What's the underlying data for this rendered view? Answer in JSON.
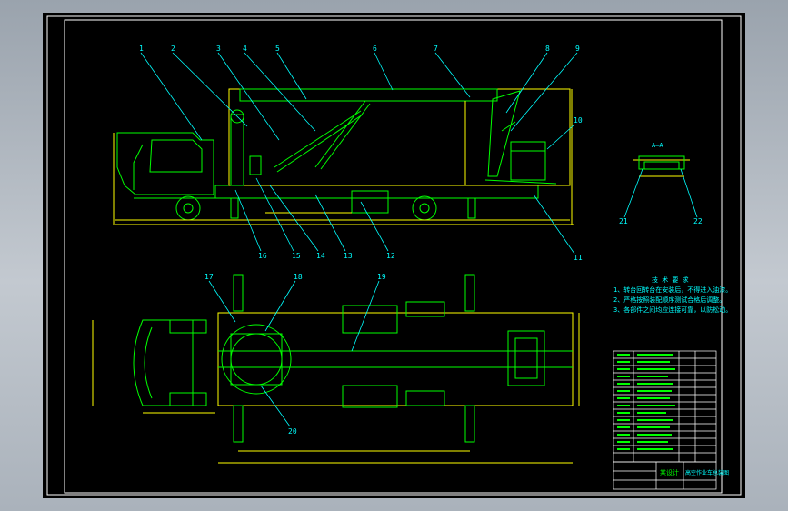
{
  "colors": {
    "background": "#000000",
    "frame": "#ffffff",
    "geometry": "#00ff00",
    "outline": "#ffff00",
    "leader": "#00ffff",
    "annotation": "#00ffff",
    "dimension": "#ffff00"
  },
  "side_view": {
    "callouts": [
      "1",
      "2",
      "3",
      "4",
      "5",
      "6",
      "7",
      "8",
      "9",
      "10",
      "11",
      "12",
      "13",
      "14",
      "15",
      "16"
    ]
  },
  "section": {
    "title": "A—A",
    "callouts": [
      "21",
      "22"
    ]
  },
  "plan_view": {
    "callouts": [
      "17",
      "18",
      "19",
      "20"
    ]
  },
  "tech_requirements": {
    "title": "技 术 要 求",
    "lines": [
      "1、转台回转台在安装后，不得进入油漆。",
      "2、严格按照装配顺序测试合格后调整。",
      "3、各部件之间均应连接可靠，以防松动。"
    ]
  },
  "title_block": {
    "org": "某设计",
    "drawing_title": "高空作业车总装图"
  }
}
